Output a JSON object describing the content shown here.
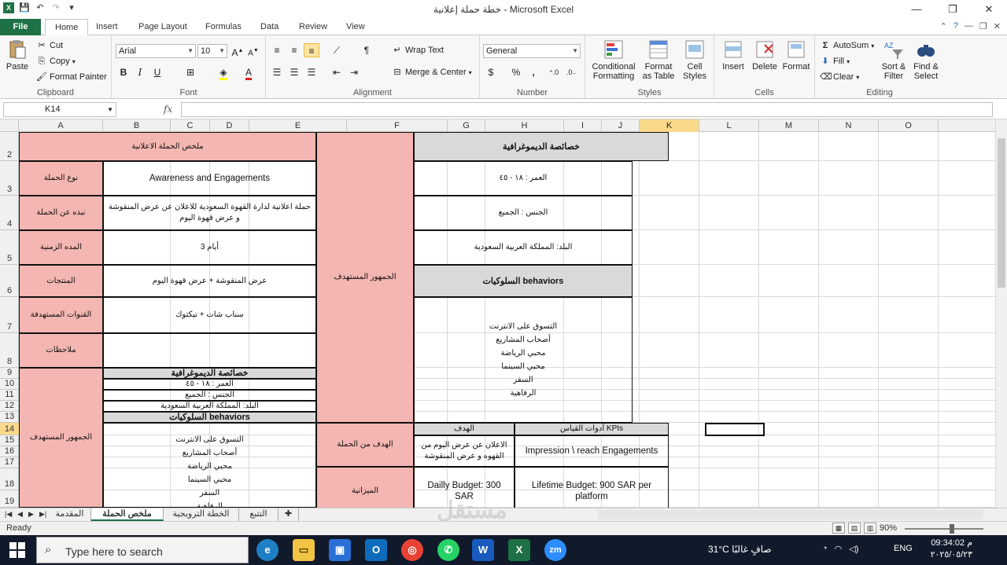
{
  "window": {
    "title": "خطة حملة إعلانية  -  Microsoft Excel",
    "minimize": "—",
    "restore": "❐",
    "close": "✕"
  },
  "menu": {
    "file": "File",
    "tabs": [
      "Home",
      "Insert",
      "Page Layout",
      "Formulas",
      "Data",
      "Review",
      "View"
    ]
  },
  "ribbon": {
    "clipboard": {
      "paste": "Paste",
      "cut": "Cut",
      "copy": "Copy",
      "format_painter": "Format Painter",
      "label": "Clipboard"
    },
    "font": {
      "name": "Arial",
      "size": "10",
      "bold": "B",
      "italic": "I",
      "underline": "U",
      "label": "Font"
    },
    "alignment": {
      "wrap_text": "Wrap Text",
      "merge_center": "Merge & Center",
      "label": "Alignment"
    },
    "number": {
      "format": "General",
      "label": "Number",
      "currency": "$",
      "percent": "%",
      "comma": ",",
      "inc_dec": "€.0 .00",
      "dec_dec": ".00 →.0"
    },
    "styles": {
      "conditional": "Conditional Formatting",
      "format_table": "Format as Table",
      "cell_styles": "Cell Styles",
      "label": "Styles"
    },
    "cells": {
      "insert": "Insert",
      "delete": "Delete",
      "format": "Format",
      "label": "Cells"
    },
    "editing": {
      "autosum": "AutoSum",
      "fill": "Fill",
      "clear": "Clear",
      "sort_filter": "Sort & Filter",
      "find_select": "Find & Select",
      "label": "Editing"
    }
  },
  "formula_bar": {
    "name_box": "K14",
    "fx": "fx",
    "value": ""
  },
  "columns": [
    "A",
    "B",
    "C",
    "D",
    "E",
    "F",
    "G",
    "H",
    "I",
    "J",
    "K",
    "L",
    "M",
    "N",
    "O"
  ],
  "selected_column": "K",
  "rows": [
    "2",
    "3",
    "4",
    "5",
    "6",
    "7",
    "8",
    "9",
    "10",
    "11",
    "12",
    "13",
    "14",
    "15",
    "16",
    "17",
    "18",
    "19"
  ],
  "selected_row": "14",
  "sheet": {
    "summary_title": "ملخص الحملة الاعلانية",
    "campaign_type_label": "نوع الحملة",
    "campaign_type_value": "Awareness and Engagements",
    "about_label": "نبذه عن الحملة",
    "about_value": "حملة اعلانية لدارة القهوة السعودية للاعلان عن عرض المنقوشة و عرض قهوة اليوم",
    "duration_label": "المده الزمنية",
    "duration_value": "أيام 3",
    "products_label": "المنتجات",
    "products_value": "عرض المنقوشة + عرض قهوة اليوم",
    "channels_label": "القنوات المستهدفة",
    "channels_value": "سناب شات + تيكتوك",
    "notes_label": "ملاحظات",
    "notes_value": "",
    "audience_label": "الجمهور المستهدف",
    "demographics_title": "خصائصة الديموغرافية",
    "age": "العمر : ١٨ - ٤٥",
    "gender": "الجنس : الجميع",
    "country": "البلد: المملكة العربية السعودية",
    "behaviors_title": "السلوكيات behaviors",
    "behaviors": [
      "التسوق على الانترنت",
      "أصحاب المشاريع",
      "محبي الرياضة",
      "محبي السينما",
      "السفر",
      "الرفاهية"
    ],
    "goal_header": "الهدف",
    "kpi_header": "أدوات القياس  KPIs",
    "campaign_goal_label": "الهدف من الحملة",
    "campaign_goal_value": "الاعلان عن عرض اليوم من القهوه و عرض المنقوشة",
    "kpi_value": "Impression \\ reach Engagements",
    "budget_label": "الميزانية",
    "daily_budget": "Dailly Budget: 300 SAR",
    "lifetime_budget": "Lifetime Budget: 900 SAR per platform"
  },
  "sheet_tabs": [
    "المقدمة",
    "ملخص الحملة",
    "الخطة الترويجية",
    "التتبع"
  ],
  "active_sheet": "ملخص الحملة",
  "status": {
    "ready": "Ready",
    "zoom": "90%"
  },
  "watermark": "مستقل",
  "taskbar": {
    "search_placeholder": "Type here to search",
    "weather": "31°C  صافٍ غالبًا",
    "lang": "ENG",
    "time": "09:34:02 م",
    "date": "٢٠٢٥/٠٥/٢٣"
  }
}
